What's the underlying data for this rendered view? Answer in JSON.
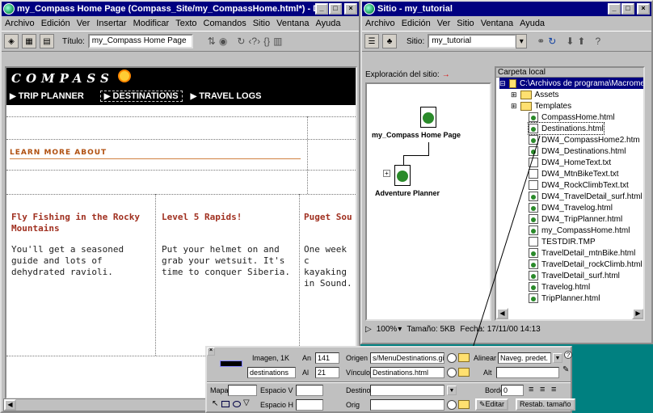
{
  "dw_window": {
    "title": "my_Compass Home Page (Compass_Site/my_CompassHome.html*) - Dr...",
    "menu": [
      "Archivo",
      "Edición",
      "Ver",
      "Insertar",
      "Modificar",
      "Texto",
      "Comandos",
      "Sitio",
      "Ventana",
      "Ayuda"
    ],
    "toolbar": {
      "title_label": "Título:",
      "title_value": "my_Compass Home Page"
    }
  },
  "page": {
    "logo": "COMPASS",
    "nav": [
      "TRIP PLANNER",
      "DESTINATIONS",
      "TRAVEL LOGS"
    ],
    "learn_more": "LEARN MORE ABOUT",
    "columns": [
      {
        "heading": "Fly Fishing in the Rocky Mountains",
        "text": "You'll get a seasoned guide and lots of dehydrated ravioli."
      },
      {
        "heading": "Level 5 Rapids!",
        "text": "Put your helmet on and grab your wetsuit. It's time to conquer Siberia."
      },
      {
        "heading": "Puget Sou",
        "text": "One week c kayaking in Sound."
      }
    ]
  },
  "site_window": {
    "title": "Sitio - my_tutorial",
    "menu": [
      "Archivo",
      "Edición",
      "Ver",
      "Sitio",
      "Ventana",
      "Ayuda"
    ],
    "site_label": "Sitio:",
    "site_value": "my_tutorial",
    "explore_label": "Exploración del sitio:",
    "map_home": "my_Compass Home Page",
    "map_child": "Adventure Planner",
    "folder_header": "Carpeta local",
    "root_path": "C:\\Archivos de programa\\Macrome",
    "files": [
      "Assets",
      "Templates",
      "CompassHome.html",
      "Destinations.html",
      "DW4_CompassHome2.htm",
      "DW4_Destinations.html",
      "DW4_HomeText.txt",
      "DW4_MtnBikeText.txt",
      "DW4_RockClimbText.txt",
      "DW4_TravelDetail_surf.html",
      "DW4_Travelog.html",
      "DW4_TripPlanner.html",
      "my_CompassHome.html",
      "TESTDIR.TMP",
      "TravelDetail_mtnBike.html",
      "TravelDetail_rockClimb.html",
      "TravelDetail_surf.html",
      "Travelog.html",
      "TripPlanner.html"
    ],
    "status": {
      "zoom": "100%",
      "size": "Tamaño: 5KB",
      "date": "Fecha: 17/11/00 14:13"
    }
  },
  "properties": {
    "type": "Imagen, 1K",
    "name": "destinations",
    "w_label": "An",
    "w": "141",
    "h_label": "Al",
    "h": "21",
    "src_label": "Origen",
    "src": "s/MenuDestinations.gif",
    "link_label": "Vínculo",
    "link": "Destinations.html",
    "align_label": "Alinear",
    "align": "Naveg. predet.",
    "alt_label": "Alt",
    "map_label": "Mapa",
    "vspace_label": "Espacio V",
    "hspace_label": "Espacio H",
    "target_label": "Destino",
    "border_label": "Borde",
    "border": "0",
    "low_label": "Orig",
    "edit_label": "Editar",
    "reset_label": "Restab. tamaño"
  }
}
